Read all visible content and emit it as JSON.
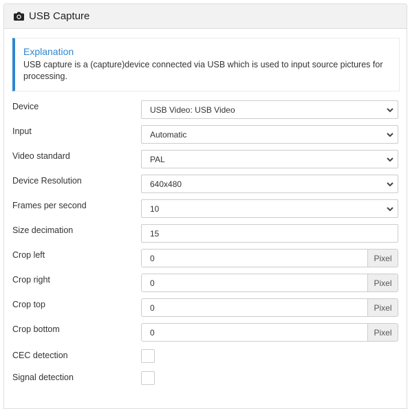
{
  "panel": {
    "title": "USB Capture",
    "icon": "camera-icon"
  },
  "explanation": {
    "title": "Explanation",
    "text": "USB capture is a (capture)device connected via USB which is used to input source pictures for processing.",
    "accent_color": "#2f86d1"
  },
  "fields": {
    "device": {
      "label": "Device",
      "value": "USB Video: USB Video"
    },
    "input": {
      "label": "Input",
      "value": "Automatic"
    },
    "video_standard": {
      "label": "Video standard",
      "value": "PAL"
    },
    "device_resolution": {
      "label": "Device Resolution",
      "value": "640x480"
    },
    "fps": {
      "label": "Frames per second",
      "value": "10"
    },
    "size_decimation": {
      "label": "Size decimation",
      "value": "15"
    },
    "crop_left": {
      "label": "Crop left",
      "value": "0",
      "unit": "Pixel"
    },
    "crop_right": {
      "label": "Crop right",
      "value": "0",
      "unit": "Pixel"
    },
    "crop_top": {
      "label": "Crop top",
      "value": "0",
      "unit": "Pixel"
    },
    "crop_bottom": {
      "label": "Crop bottom",
      "value": "0",
      "unit": "Pixel"
    },
    "cec_detection": {
      "label": "CEC detection",
      "checked": false
    },
    "signal_detection": {
      "label": "Signal detection",
      "checked": false
    }
  }
}
